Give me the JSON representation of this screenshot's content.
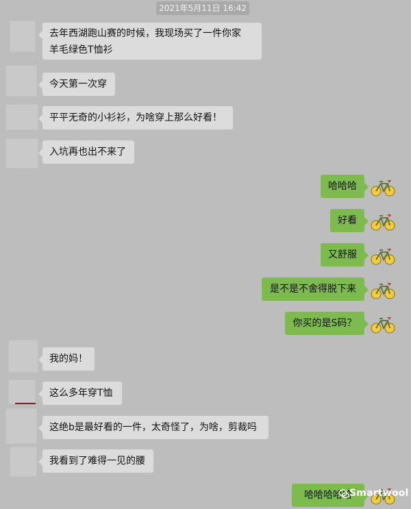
{
  "timestamp": "2021年5月11日 16:42",
  "messages_in": [
    {
      "line1": "去年西湖跑山赛的时候，我现场买了一件你家",
      "line2": "羊毛绿色T恤衫"
    },
    {
      "text": "今天第一次穿"
    },
    {
      "text": "平平无奇的小衫衫，为啥穿上那么好看！"
    },
    {
      "text": "入坑再也出不来了"
    },
    {
      "text": "我的妈！"
    },
    {
      "text": "这么多年穿T恤"
    },
    {
      "text": "这绝b是最好看的一件，太奇怪了，为啥，剪裁吗"
    },
    {
      "text": "我看到了难得一见的腰"
    }
  ],
  "messages_out": [
    {
      "text": "哈哈哈"
    },
    {
      "text": "好看"
    },
    {
      "text": "又舒服"
    },
    {
      "text": "是不是不舍得脱下来"
    },
    {
      "text": "你买的是S码？"
    },
    {
      "text": "哈哈哈哈哈"
    }
  ],
  "watermark": "Smartwool",
  "colors": {
    "background": "#bdbdbd",
    "incoming_bubble": "#dcdcdc",
    "outgoing_bubble": "#7dbb4f",
    "avatar_placeholder": "#c9c9c9"
  },
  "icons": {
    "outgoing_avatar": "bicycle-icon",
    "watermark_logo": "wechat-icon"
  }
}
